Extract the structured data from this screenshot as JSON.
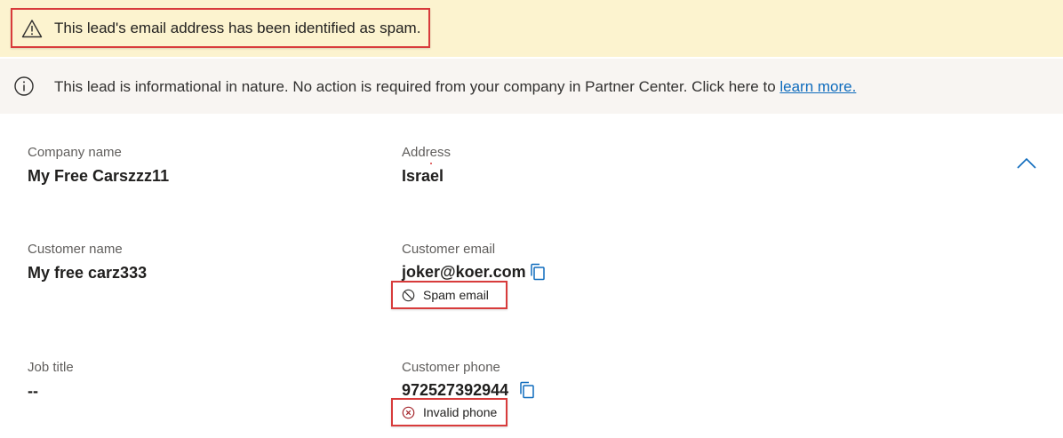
{
  "warning": {
    "text": "This lead's email address has been identified as spam.",
    "icon": "warning-triangle-icon"
  },
  "info": {
    "text": "This lead is informational in nature. No action is required from your company in Partner Center. Click here to ",
    "link": "learn more.",
    "icon": "info-circle-icon"
  },
  "fields": {
    "company_name": {
      "label": "Company name",
      "value": "My Free Carszzz11"
    },
    "address": {
      "label": "Address",
      "value": "Israel"
    },
    "customer_name": {
      "label": "Customer name",
      "value": "My free carz333"
    },
    "customer_email": {
      "label": "Customer email",
      "value": "joker@koer.com",
      "tag": "Spam email"
    },
    "job_title": {
      "label": "Job title",
      "value": "--"
    },
    "customer_phone": {
      "label": "Customer phone",
      "value": "972527392944",
      "tag": "Invalid phone"
    }
  },
  "colors": {
    "warning_bg": "#fcf3cf",
    "info_bg": "#f8f5f2",
    "highlight_border": "#d83b3b",
    "link": "#0f6cbd",
    "accent": "#0f6cbd"
  }
}
